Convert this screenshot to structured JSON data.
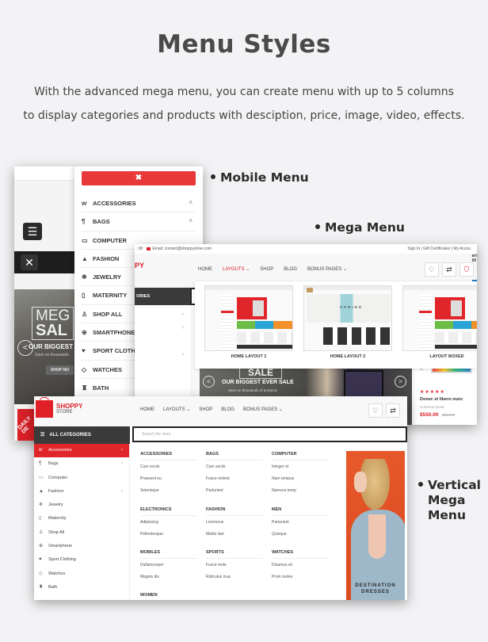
{
  "header": {
    "title": "Menu Styles",
    "subtitle_line1": "With the advanced mega menu, you can create menu with up to 5 columns",
    "subtitle_line2": "to display categories and products with desciption, price, image, video, effects."
  },
  "labels": {
    "mobile": "Mobile Menu",
    "mega": "Mega Menu",
    "vertical_line1": "Vertical",
    "vertical_line2": "Mega",
    "vertical_line3": "Menu"
  },
  "mobile_menu": {
    "close_label": "✖",
    "hamburger_icon": "☰",
    "close_icon": "✕",
    "hero": {
      "mega": "MEG",
      "sale": "SAL",
      "headline": "OUR BIGGEST E",
      "sub": "Save on thousands",
      "button": "SHOP NO"
    },
    "daily_badge": "DAILY DE",
    "items": [
      {
        "icon": "ⱳ",
        "label": "ACCESSORIES",
        "chevron": "^"
      },
      {
        "icon": "¶",
        "label": "BAGS",
        "chevron": "^"
      },
      {
        "icon": "▭",
        "label": "COMPUTER",
        "chevron": ""
      },
      {
        "icon": "▲",
        "label": "FASHION",
        "chevron": ""
      },
      {
        "icon": "❄",
        "label": "JEWELRY",
        "chevron": ""
      },
      {
        "icon": "▯",
        "label": "MATERNITY",
        "chevron": ""
      },
      {
        "icon": "♙",
        "label": "SHOP ALL",
        "chevron": ""
      },
      {
        "icon": "⊕",
        "label": "SMARTPHONE",
        "chevron": ""
      },
      {
        "icon": "♥",
        "label": "SPORT CLOTHIN",
        "chevron": ""
      },
      {
        "icon": "◇",
        "label": "WATCHES",
        "chevron": ""
      },
      {
        "icon": "♜",
        "label": "BATH",
        "chevron": ""
      }
    ]
  },
  "mega_menu": {
    "phone_fragment": ": 90",
    "email": "Email: contact@shoppystore.com",
    "top_links": "Sign In   |   Gift Certificates   |   My Accou",
    "cart_text": "art",
    "cart_sub": "00",
    "logo_fragment": "PY",
    "nav": [
      "HOME",
      "LAYOUTS ⌄",
      "SHOP",
      "BLOG",
      "BONUS PAGES ⌄"
    ],
    "active_nav_index": 1,
    "all_categories_fragment": "ORIES",
    "layouts": [
      {
        "label": "HOME LAYOUT 1"
      },
      {
        "label": "HOME LAYOUT 2",
        "hero_text": "SPRING"
      },
      {
        "label": "LAYOUT BOXED"
      }
    ],
    "slider": {
      "sale": "SALE",
      "headline": "OUR BIGGEST EVER SALE",
      "sub": "Save on thousands of products"
    },
    "product": {
      "stars": "★★★★★",
      "name": "Donec et libero nunc",
      "brand": "Common Good",
      "price": "$550.00",
      "old_price": "$654.00"
    },
    "colors": {
      "accent": "#d82027",
      "blue": "#1e7ac2"
    }
  },
  "vertical_menu": {
    "brand_line1": "SHOPPY",
    "brand_line2": "STORE",
    "nav": [
      "HOME",
      "LAYOUTS ⌄",
      "SHOP",
      "BLOG",
      "BONUS PAGES ⌄"
    ],
    "all_categories": "ALL CATEGORIES",
    "search_placeholder": "Search the store",
    "categories": [
      {
        "icon": "ⱳ",
        "label": "Accessories",
        "chevron": "›",
        "active": true
      },
      {
        "icon": "¶",
        "label": "Bags",
        "chevron": "›"
      },
      {
        "icon": "▭",
        "label": "Computer",
        "chevron": ""
      },
      {
        "icon": "▲",
        "label": "Fashion",
        "chevron": "›"
      },
      {
        "icon": "❄",
        "label": "Jewelry",
        "chevron": ""
      },
      {
        "icon": "▯",
        "label": "Maternity",
        "chevron": ""
      },
      {
        "icon": "♙",
        "label": "Shop All",
        "chevron": ""
      },
      {
        "icon": "⊕",
        "label": "Smartphone",
        "chevron": ""
      },
      {
        "icon": "♥",
        "label": "Sport Clothing",
        "chevron": ""
      },
      {
        "icon": "◇",
        "label": "Watches",
        "chevron": ""
      },
      {
        "icon": "♜",
        "label": "Bath",
        "chevron": ""
      }
    ],
    "groups": [
      {
        "heading": "ACCESSORIES",
        "items": [
          "Cum sociis",
          "Praesent eu",
          "Selerisque"
        ]
      },
      {
        "heading": "BAGS",
        "items": [
          "Cum sociis",
          "Fusce molest",
          "Parturient"
        ]
      },
      {
        "heading": "COMPUTER",
        "items": [
          "Integer et",
          "Nam tempus",
          "Namcos temp"
        ]
      },
      {
        "heading": "ELECTRONICS",
        "items": [
          "Adipiscing",
          "Pellentesque"
        ]
      },
      {
        "heading": "FASHION",
        "items": [
          "Loremous",
          "Mattis laor"
        ]
      },
      {
        "heading": "MEN",
        "items": [
          "Parturient",
          "Quisque"
        ]
      },
      {
        "heading": "MOBILES",
        "items": [
          "Dullamcorper",
          "Magnis dis"
        ]
      },
      {
        "heading": "SPORTS",
        "items": [
          "Fusce mole",
          "Ridiculus mus"
        ]
      },
      {
        "heading": "WATCHES",
        "items": [
          "Divamus sit",
          "Proin moles"
        ]
      },
      {
        "heading": "WOMEN",
        "items": []
      }
    ],
    "banner_line1": "DESTINATION",
    "banner_line2": "DRESSES"
  }
}
